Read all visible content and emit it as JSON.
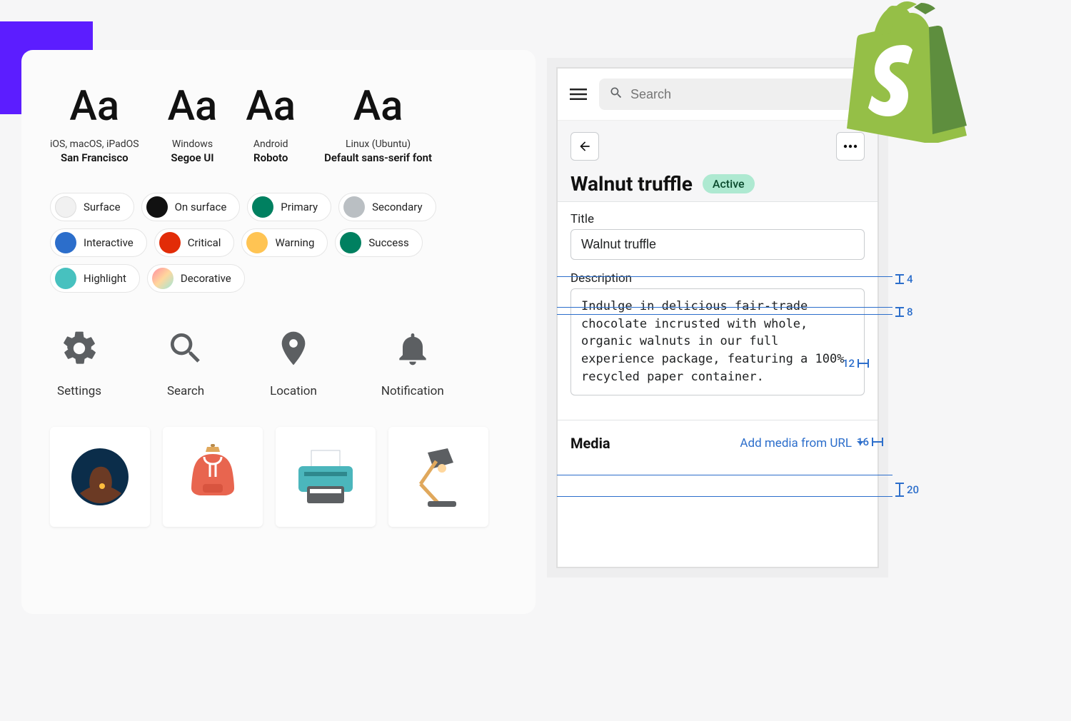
{
  "typography": [
    {
      "sample": "Aa",
      "os": "iOS, macOS, iPadOS",
      "font": "San Francisco"
    },
    {
      "sample": "Aa",
      "os": "Windows",
      "font": "Segoe UI"
    },
    {
      "sample": "Aa",
      "os": "Android",
      "font": "Roboto"
    },
    {
      "sample": "Aa",
      "os": "Linux (Ubuntu)",
      "font": "Default sans-serif font"
    }
  ],
  "colors": [
    {
      "label": "Surface",
      "hex": "#f1f1f1"
    },
    {
      "label": "On surface",
      "hex": "#111111"
    },
    {
      "label": "Primary",
      "hex": "#008060"
    },
    {
      "label": "Secondary",
      "hex": "#babfc3"
    },
    {
      "label": "Interactive",
      "hex": "#2c6ecb"
    },
    {
      "label": "Critical",
      "hex": "#e22c08"
    },
    {
      "label": "Warning",
      "hex": "#ffc453"
    },
    {
      "label": "Success",
      "hex": "#008060"
    },
    {
      "label": "Highlight",
      "hex": "#47c1bf"
    },
    {
      "label": "Decorative",
      "hex": "linear-gradient(135deg,#ff8da1,#ffd79d,#9fe7d9)"
    }
  ],
  "icons": [
    {
      "name": "gear-icon",
      "label": "Settings"
    },
    {
      "name": "search-icon",
      "label": "Search"
    },
    {
      "name": "pin-icon",
      "label": "Location"
    },
    {
      "name": "bell-icon",
      "label": "Notification"
    }
  ],
  "illustrations": [
    {
      "name": "avatar-illustration"
    },
    {
      "name": "hoodie-illustration"
    },
    {
      "name": "printer-illustration"
    },
    {
      "name": "lamp-illustration"
    }
  ],
  "mobile": {
    "search_placeholder": "Search",
    "product_title": "Walnut truffle",
    "status_badge": "Active",
    "fields": {
      "title_label": "Title",
      "title_value": "Walnut truffle",
      "description_label": "Description",
      "description_value": "Indulge in delicious fair-trade chocolate incrusted with whole, organic walnuts in our full experience package, featuring a 100% recycled paper container."
    },
    "media": {
      "label": "Media",
      "action": "Add media from URL"
    }
  },
  "spacing_annotations": [
    "4",
    "8",
    "12",
    "16",
    "20"
  ]
}
